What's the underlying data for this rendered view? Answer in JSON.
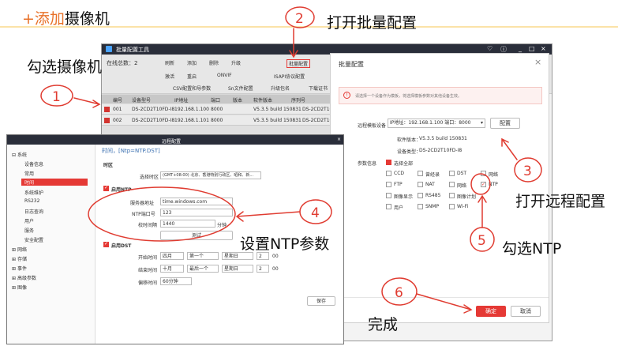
{
  "annotations": {
    "add_camera_prefix": "+添加",
    "add_camera_suffix": "摄像机",
    "open_batch_config": "打开批量配置",
    "check_camera": "勾选摄像机",
    "open_remote_config": "打开远程配置",
    "set_ntp_params": "设置NTP参数",
    "check_ntp": "勾选NTP",
    "done": "完成",
    "steps": [
      "1",
      "2",
      "3",
      "4",
      "5",
      "6"
    ]
  },
  "tool_window": {
    "title": "批量配置工具",
    "online_count": "在线总数：2",
    "toolbar": [
      "刷新",
      "添加",
      "删除",
      "升级",
      "批量配置",
      "ISAPI",
      "激活",
      "重启",
      "ONVIF",
      "ISAPI协议配置",
      "CSV配置和导参数",
      "Sn文件配置",
      "升级包名",
      "下载证书"
    ],
    "grid_headers": [
      "编号",
      "设备型号",
      "IP地址",
      "端口",
      "版本",
      "软件版本",
      "序列号"
    ],
    "rows": [
      {
        "no": "001",
        "model": "DS-2CD2T10FD-I8",
        "ip": "192.168.1.100",
        "port": "8000",
        "version": "V5.3.5 build 150831",
        "serial": "DS-2CD2T10"
      },
      {
        "no": "002",
        "model": "DS-2CD2T10FD-I8",
        "ip": "192.168.1.101",
        "port": "8000",
        "version": "V5.3.5 build 150831",
        "serial": "DS-2CD2T10"
      }
    ]
  },
  "batch_modal": {
    "title": "批量配置",
    "warning": "请选择一个设备作为模板，将选择模板参数对其他设备生效。",
    "template_label": "远程模板设备",
    "template_value": "IP地址：192.168.1.100 端口：8000",
    "config_button": "配置",
    "software_label": "软件版本：",
    "software_value": "V5.3.5 build 150831",
    "device_type_label": "设备类型：",
    "device_type_value": "DS-2CD2T10FD-I8",
    "params_label": "参数信息",
    "select_all": "选择全部",
    "options": [
      {
        "label": "CCD",
        "checked": false
      },
      {
        "label": "曾经录",
        "checked": false
      },
      {
        "label": "DST",
        "checked": false
      },
      {
        "label": "网络",
        "checked": false
      },
      {
        "label": "FTP",
        "checked": false
      },
      {
        "label": "NAT",
        "checked": false
      },
      {
        "label": "网络",
        "checked": false
      },
      {
        "label": "NTP",
        "checked": true
      },
      {
        "label": "图像显示",
        "checked": false
      },
      {
        "label": "RS485",
        "checked": false
      },
      {
        "label": "图像计划",
        "checked": false
      },
      {
        "label": "用户",
        "checked": false
      },
      {
        "label": "SNMP",
        "checked": false
      },
      {
        "label": "Wi-Fi",
        "checked": false
      }
    ],
    "confirm": "确定",
    "cancel": "取消"
  },
  "remote_window": {
    "title": "远程配置",
    "tree": [
      "系统",
      "设备信息",
      "常用",
      "时间",
      "系统维护",
      "RS232",
      "日志查询",
      "用户",
      "服务",
      "安全配置",
      "网络",
      "存储",
      "事件",
      "高级参数",
      "图像"
    ],
    "time_header": "时间，[Ntp=NTP.DST]",
    "timezone_section": "时区",
    "timezone_label": "选择时区",
    "timezone_value": "(GMT+08:00) 北京、香港特别行政区、昭和、新...",
    "enable_ntp": "启用NTP",
    "server_label": "服务器地址",
    "server_value": "time.windows.com",
    "ntp_port_label": "NTP端口号",
    "ntp_port_value": "123",
    "interval_label": "校时间隔",
    "interval_value": "1440",
    "interval_unit": "分钟",
    "test_button": "测试",
    "enable_dst": "启用DST",
    "start_label": "开始时间",
    "start_values": [
      "四月",
      "第一个",
      "星期日",
      "2",
      "00"
    ],
    "end_label": "结束时间",
    "end_values": [
      "十月",
      "最后一个",
      "星期日",
      "2",
      "00"
    ],
    "offset_label": "偏移时间",
    "offset_value": "60分钟",
    "save_button": "保存"
  }
}
